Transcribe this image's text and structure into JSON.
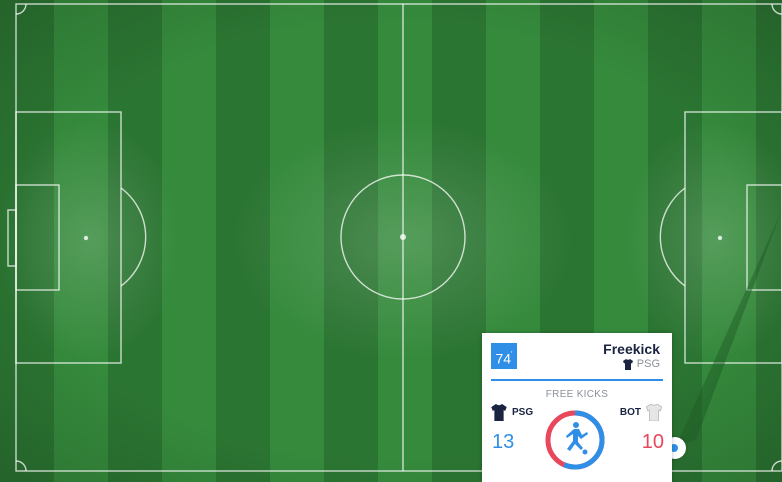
{
  "event": {
    "minute": "74",
    "minute_mark": "'",
    "title": "Freekick",
    "team": "PSG"
  },
  "stat": {
    "label": "FREE KICKS",
    "home_team": "PSG",
    "home_value": "13",
    "away_team": "BOT",
    "away_value": "10",
    "home_share": 0.565
  },
  "colors": {
    "home": "#2f8fe6",
    "away": "#e8475c",
    "pitch_dark": "#2b7532",
    "pitch_light": "#358a3c",
    "lines": "#ffffff"
  },
  "icons": {
    "home_shirt": "shirt-icon-navy",
    "away_shirt": "shirt-icon-white",
    "player": "footballer-icon",
    "ball_marker": "ball-position-marker"
  }
}
